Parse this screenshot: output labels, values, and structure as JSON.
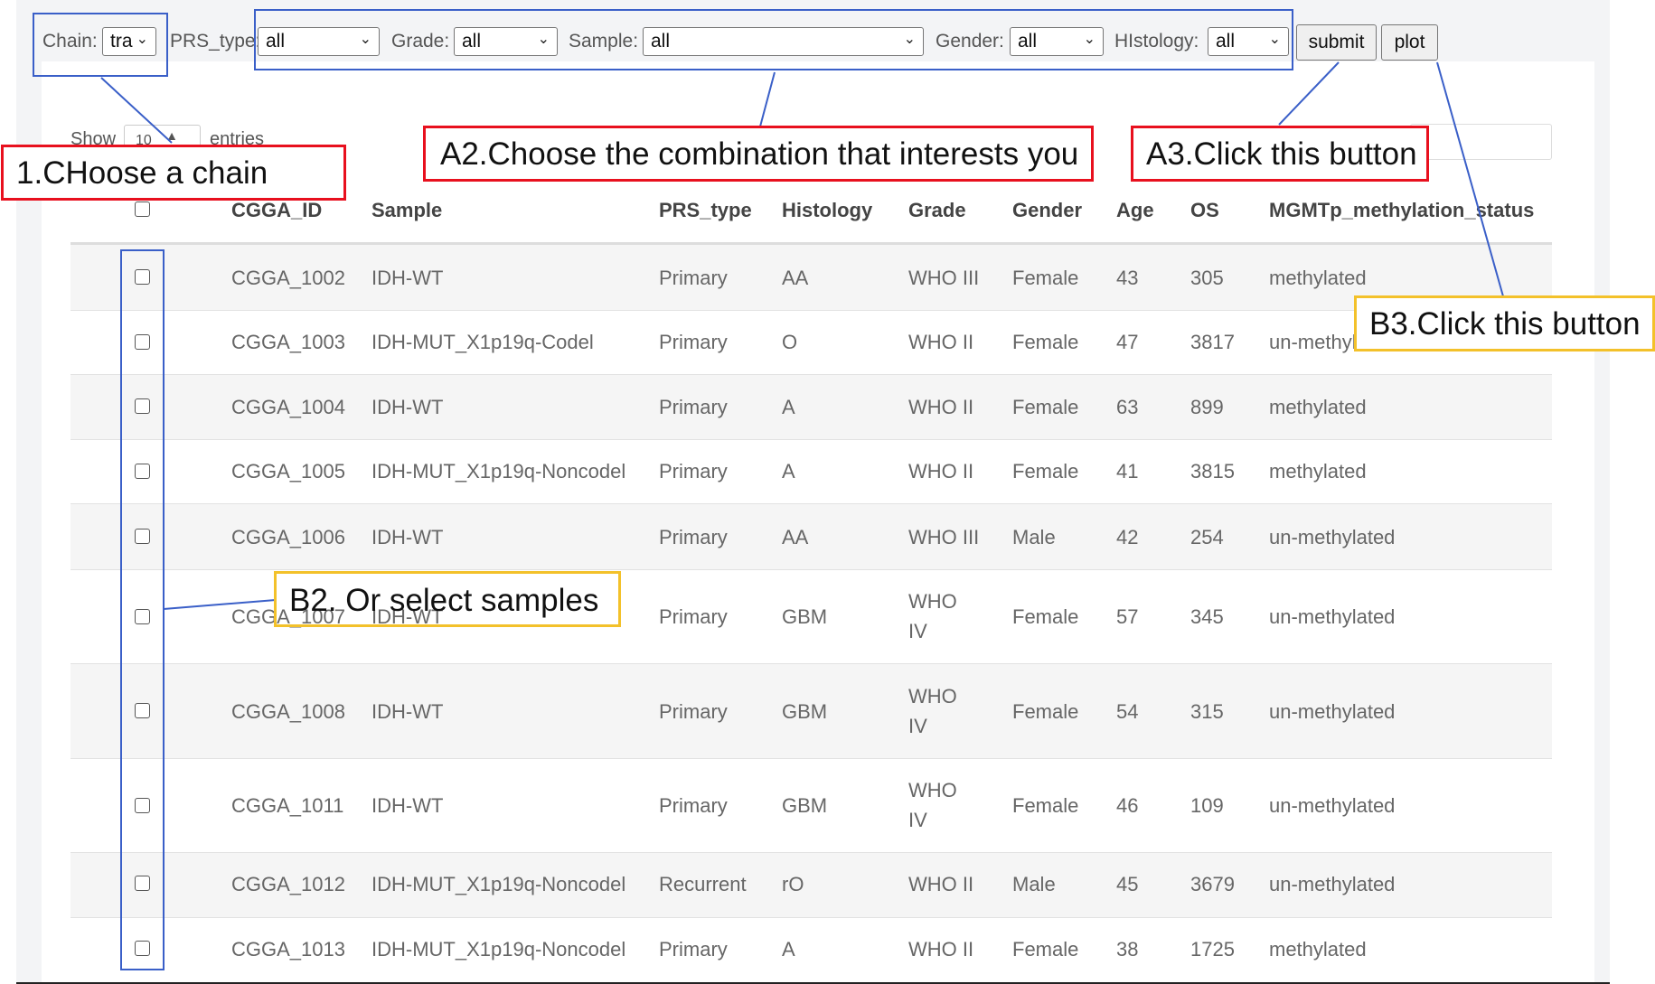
{
  "filters": {
    "chain": {
      "label": "Chain:",
      "value": "tra"
    },
    "prs_type": {
      "label": "PRS_type:",
      "value": "all"
    },
    "grade": {
      "label": "Grade:",
      "value": "all"
    },
    "sample": {
      "label": "Sample:",
      "value": "all"
    },
    "gender": {
      "label": "Gender:",
      "value": "all"
    },
    "histology": {
      "label": "HIstology:",
      "value": "all"
    },
    "submit_label": "submit",
    "plot_label": "plot"
  },
  "datatable": {
    "show_label": "Show",
    "length_value": "10",
    "entries_label": "entries"
  },
  "table": {
    "headers": [
      "CGGA_ID",
      "Sample",
      "PRS_type",
      "Histology",
      "Grade",
      "Gender",
      "Age",
      "OS",
      "MGMTp_methylation_status"
    ],
    "rows": [
      {
        "id": "CGGA_1002",
        "sample": "IDH-WT",
        "prs": "Primary",
        "hist": "AA",
        "grade": "WHO III",
        "gender": "Female",
        "age": "43",
        "os": "305",
        "mgmt": "methylated"
      },
      {
        "id": "CGGA_1003",
        "sample": "IDH-MUT_X1p19q-Codel",
        "prs": "Primary",
        "hist": "O",
        "grade": "WHO II",
        "gender": "Female",
        "age": "47",
        "os": "3817",
        "mgmt": "un-methylated"
      },
      {
        "id": "CGGA_1004",
        "sample": "IDH-WT",
        "prs": "Primary",
        "hist": "A",
        "grade": "WHO II",
        "gender": "Female",
        "age": "63",
        "os": "899",
        "mgmt": "methylated"
      },
      {
        "id": "CGGA_1005",
        "sample": "IDH-MUT_X1p19q-Noncodel",
        "prs": "Primary",
        "hist": "A",
        "grade": "WHO II",
        "gender": "Female",
        "age": "41",
        "os": "3815",
        "mgmt": "methylated"
      },
      {
        "id": "CGGA_1006",
        "sample": "IDH-WT",
        "prs": "Primary",
        "hist": "AA",
        "grade": "WHO III",
        "gender": "Male",
        "age": "42",
        "os": "254",
        "mgmt": "un-methylated"
      },
      {
        "id": "CGGA_1007",
        "sample": "IDH-WT",
        "prs": "Primary",
        "hist": "GBM",
        "grade": "WHO IV",
        "gender": "Female",
        "age": "57",
        "os": "345",
        "mgmt": "un-methylated"
      },
      {
        "id": "CGGA_1008",
        "sample": "IDH-WT",
        "prs": "Primary",
        "hist": "GBM",
        "grade": "WHO IV",
        "gender": "Female",
        "age": "54",
        "os": "315",
        "mgmt": "un-methylated"
      },
      {
        "id": "CGGA_1011",
        "sample": "IDH-WT",
        "prs": "Primary",
        "hist": "GBM",
        "grade": "WHO IV",
        "gender": "Female",
        "age": "46",
        "os": "109",
        "mgmt": "un-methylated"
      },
      {
        "id": "CGGA_1012",
        "sample": "IDH-MUT_X1p19q-Noncodel",
        "prs": "Recurrent",
        "hist": "rO",
        "grade": "WHO II",
        "gender": "Male",
        "age": "45",
        "os": "3679",
        "mgmt": "un-methylated"
      },
      {
        "id": "CGGA_1013",
        "sample": "IDH-MUT_X1p19q-Noncodel",
        "prs": "Primary",
        "hist": "A",
        "grade": "WHO II",
        "gender": "Female",
        "age": "38",
        "os": "1725",
        "mgmt": "methylated"
      }
    ]
  },
  "annotations": {
    "choose_chain": "1.CHoose a chain",
    "choose_combination": "A2.Choose the combination that interests you",
    "click_submit": "A3.Click this button",
    "select_samples": "B2. Or select samples",
    "click_plot": "B3.Click this button"
  },
  "colors": {
    "annotation_red": "#e8101e",
    "annotation_gold": "#f3c12a",
    "annotation_blue": "#3a5fc8"
  }
}
